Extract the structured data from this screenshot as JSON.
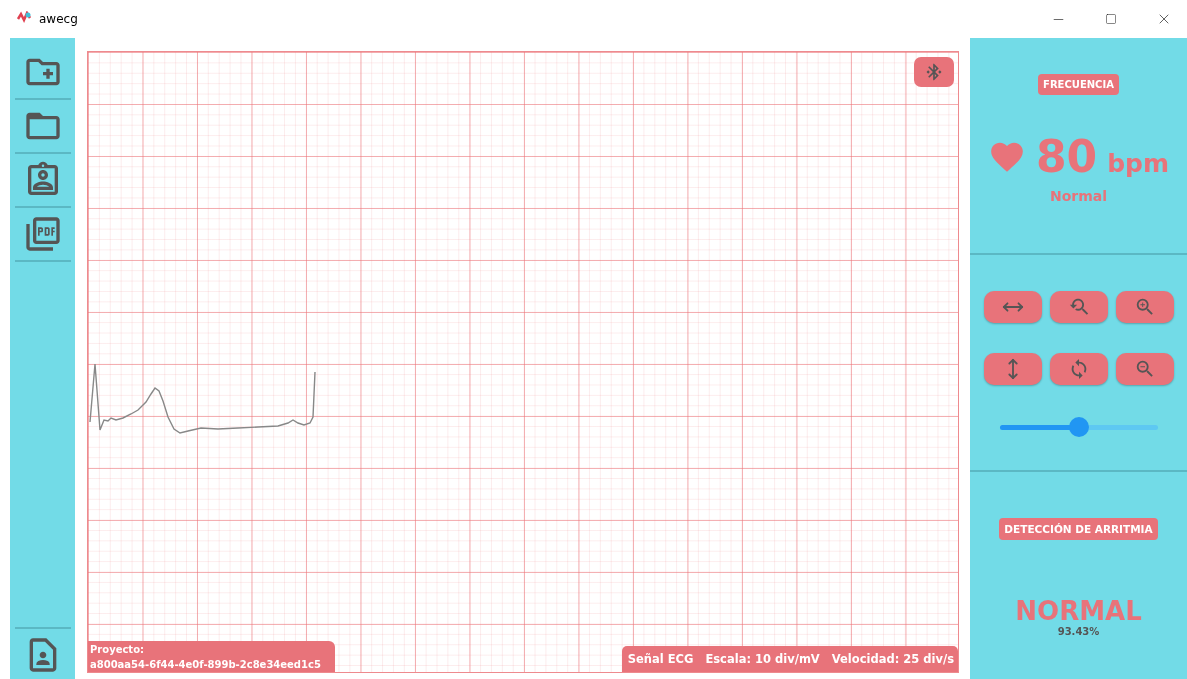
{
  "window": {
    "title": "awecg"
  },
  "heart_rate": {
    "label": "FRECUENCIA",
    "value": "80",
    "unit": "bpm",
    "status": "Normal"
  },
  "zoom_slider": {
    "level": 0.5
  },
  "arrhythmia": {
    "label": "DETECCIÓN DE ARRITMIA",
    "result": "NORMAL",
    "confidence": "93.43%"
  },
  "project": {
    "label": "Proyecto:",
    "id": "a800aa54-6f44-4e0f-899b-2c8e34eed1c5"
  },
  "signal_info": [
    "Señal ECG",
    "Escala: 10 div/mV",
    "Velocidad: 25 div/s"
  ]
}
